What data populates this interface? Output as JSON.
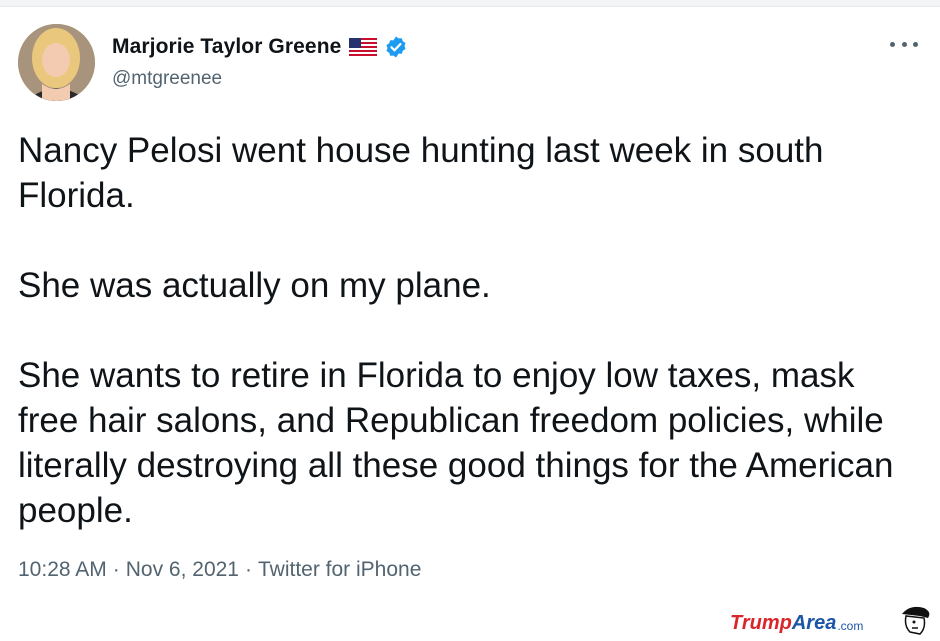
{
  "tweet": {
    "author_name": "Marjorie Taylor Greene",
    "handle": "@mtgreenee",
    "paragraphs": [
      "Nancy Pelosi went house hunting last week in south Florida.",
      "She was actually on my plane.",
      "She wants to retire in Florida to enjoy low taxes, mask free hair salons, and Republican freedom policies, while literally destroying all these good things for the American people."
    ],
    "time": "10:28 AM",
    "date": "Nov 6, 2021",
    "source": "Twitter for iPhone",
    "separator": "·"
  },
  "icons": {
    "flag": "us-flag-icon",
    "verified": "verified-badge-icon",
    "more": "more-options-icon"
  },
  "watermark": {
    "part1": "Trump",
    "part2": "Area",
    "part3": ".com"
  },
  "colors": {
    "text": "#0f1419",
    "secondary": "#536471",
    "verified": "#1d9bf0",
    "watermark_red": "#d9262a",
    "watermark_blue": "#1b55a6"
  }
}
